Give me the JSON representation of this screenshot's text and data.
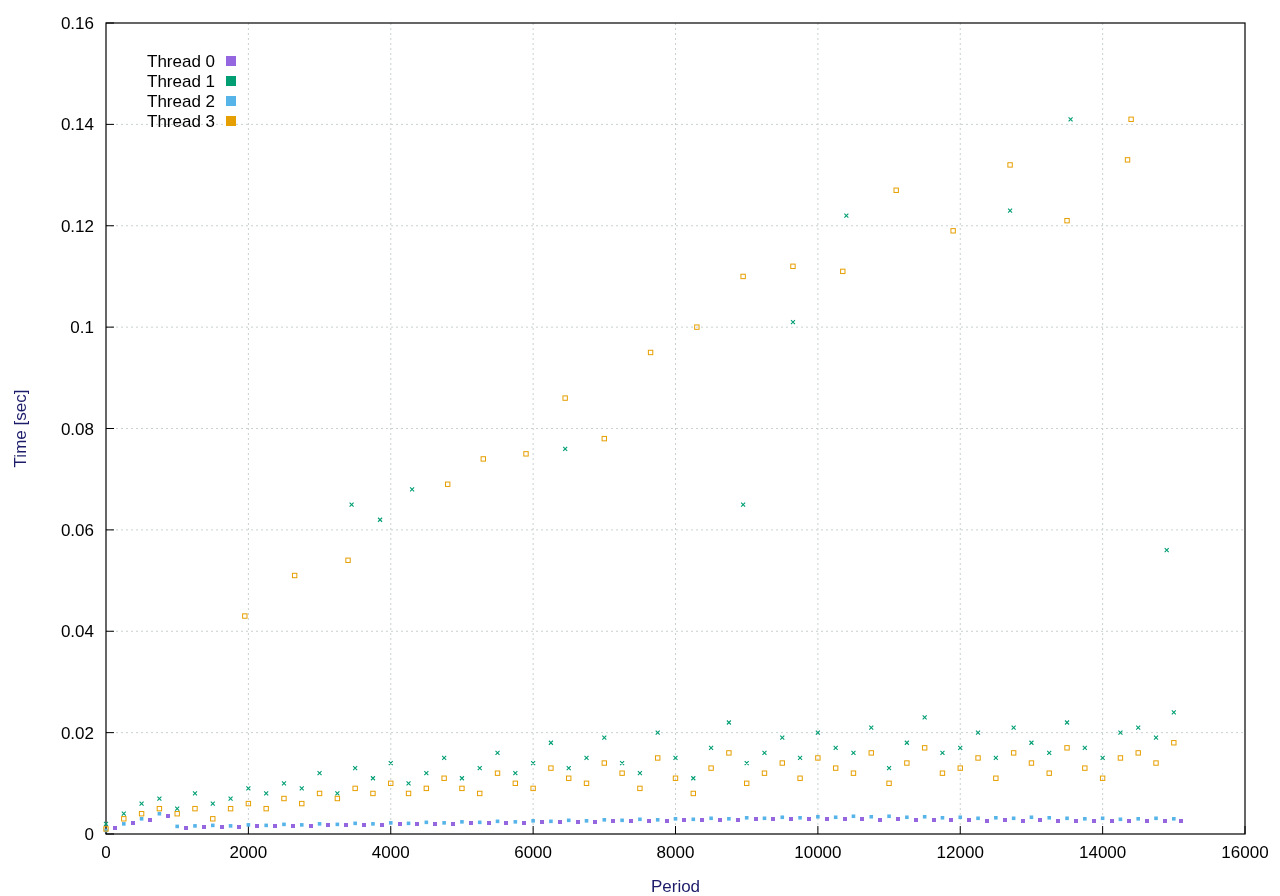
{
  "chart_data": {
    "type": "scatter",
    "grid": true,
    "legend": true,
    "xlabel": "Period",
    "ylabel": "Time [sec]",
    "xlim": [
      0,
      16000
    ],
    "ylim": [
      0,
      0.16
    ],
    "xticks": [
      0,
      2000,
      4000,
      6000,
      8000,
      10000,
      12000,
      14000,
      16000
    ],
    "yticks": [
      0,
      0.02,
      0.04,
      0.06,
      0.08,
      0.1,
      0.12,
      0.14,
      0.16
    ],
    "series": [
      {
        "name": "Thread 0",
        "color": "#9467e0",
        "x": [
          125,
          375,
          625,
          875,
          1125,
          1375,
          1625,
          1875,
          2125,
          2375,
          2625,
          2875,
          3125,
          3375,
          3625,
          3875,
          4125,
          4375,
          4625,
          4875,
          5125,
          5375,
          5625,
          5875,
          6125,
          6375,
          6625,
          6875,
          7125,
          7375,
          7625,
          7875,
          8125,
          8375,
          8625,
          8875,
          9125,
          9375,
          9625,
          9875,
          10125,
          10375,
          10625,
          10875,
          11125,
          11375,
          11625,
          11875,
          12125,
          12375,
          12625,
          12875,
          13125,
          13375,
          13625,
          13875,
          14125,
          14375,
          14625,
          14875,
          15100
        ],
        "values": [
          0.0012,
          0.0022,
          0.0028,
          0.0035,
          0.0012,
          0.0013,
          0.0014,
          0.0014,
          0.0015,
          0.0015,
          0.0016,
          0.0016,
          0.0017,
          0.0017,
          0.0018,
          0.0018,
          0.0019,
          0.0019,
          0.002,
          0.002,
          0.0021,
          0.0021,
          0.0022,
          0.0022,
          0.0023,
          0.0023,
          0.0024,
          0.0024,
          0.0025,
          0.0025,
          0.0026,
          0.0026,
          0.0027,
          0.0027,
          0.0028,
          0.0028,
          0.0029,
          0.0029,
          0.003,
          0.003,
          0.003,
          0.0029,
          0.003,
          0.0028,
          0.0029,
          0.0027,
          0.0028,
          0.0027,
          0.0028,
          0.0026,
          0.0027,
          0.0026,
          0.0027,
          0.0026,
          0.0025,
          0.0026,
          0.0025,
          0.0026,
          0.0025,
          0.0026,
          0.0025
        ]
      },
      {
        "name": "Thread 1",
        "color": "#009e73",
        "x": [
          0,
          250,
          500,
          750,
          1000,
          1250,
          1500,
          1750,
          2000,
          2250,
          2500,
          2750,
          3000,
          3250,
          3500,
          3750,
          4000,
          4250,
          4500,
          4750,
          5000,
          5250,
          5500,
          5750,
          6000,
          6250,
          6500,
          6750,
          7000,
          7250,
          7500,
          7750,
          8000,
          8250,
          8500,
          8750,
          9000,
          9250,
          9500,
          9750,
          10000,
          10250,
          10500,
          10750,
          11000,
          11250,
          11500,
          11750,
          12000,
          12250,
          12500,
          12750,
          13000,
          13250,
          13500,
          13750,
          14000,
          14250,
          14500,
          14750,
          15000,
          3450,
          3850,
          4300,
          6450,
          8950,
          9650,
          10400,
          12700,
          13550,
          14900
        ],
        "values": [
          0.002,
          0.004,
          0.006,
          0.007,
          0.005,
          0.008,
          0.006,
          0.007,
          0.009,
          0.008,
          0.01,
          0.009,
          0.012,
          0.008,
          0.013,
          0.011,
          0.014,
          0.01,
          0.012,
          0.015,
          0.011,
          0.013,
          0.016,
          0.012,
          0.014,
          0.018,
          0.013,
          0.015,
          0.019,
          0.014,
          0.012,
          0.02,
          0.015,
          0.011,
          0.017,
          0.022,
          0.014,
          0.016,
          0.019,
          0.015,
          0.02,
          0.017,
          0.016,
          0.021,
          0.013,
          0.018,
          0.023,
          0.016,
          0.017,
          0.02,
          0.015,
          0.021,
          0.018,
          0.016,
          0.022,
          0.017,
          0.015,
          0.02,
          0.021,
          0.019,
          0.024,
          0.065,
          0.062,
          0.068,
          0.076,
          0.065,
          0.101,
          0.122,
          0.123,
          0.141,
          0.056
        ]
      },
      {
        "name": "Thread 2",
        "color": "#56b4e9",
        "x": [
          0,
          250,
          500,
          750,
          1000,
          1250,
          1500,
          1750,
          2000,
          2250,
          2500,
          2750,
          3000,
          3250,
          3500,
          3750,
          4000,
          4250,
          4500,
          4750,
          5000,
          5250,
          5500,
          5750,
          6000,
          6250,
          6500,
          6750,
          7000,
          7250,
          7500,
          7750,
          8000,
          8250,
          8500,
          8750,
          9000,
          9250,
          9500,
          9750,
          10000,
          10250,
          10500,
          10750,
          11000,
          11250,
          11500,
          11750,
          12000,
          12250,
          12500,
          12750,
          13000,
          13250,
          13500,
          13750,
          14000,
          14250,
          14500,
          14750,
          15000
        ],
        "values": [
          0.0007,
          0.002,
          0.003,
          0.004,
          0.0015,
          0.0016,
          0.0017,
          0.0016,
          0.0018,
          0.0017,
          0.0019,
          0.0018,
          0.002,
          0.0019,
          0.0021,
          0.002,
          0.0022,
          0.0021,
          0.0023,
          0.0022,
          0.0024,
          0.0023,
          0.0025,
          0.0024,
          0.0026,
          0.0025,
          0.0027,
          0.0026,
          0.0028,
          0.0027,
          0.0029,
          0.0028,
          0.003,
          0.0029,
          0.0031,
          0.003,
          0.0032,
          0.0031,
          0.0033,
          0.0032,
          0.0034,
          0.0033,
          0.0035,
          0.0034,
          0.0035,
          0.0033,
          0.0034,
          0.0032,
          0.0033,
          0.0031,
          0.0032,
          0.0031,
          0.0033,
          0.0032,
          0.0031,
          0.003,
          0.0031,
          0.0029,
          0.003,
          0.0031,
          0.003
        ]
      },
      {
        "name": "Thread 3",
        "color": "#e69f00",
        "x": [
          0,
          250,
          500,
          750,
          1000,
          1250,
          1500,
          1750,
          2000,
          2250,
          2500,
          2750,
          3000,
          3250,
          3500,
          3750,
          4000,
          4250,
          4500,
          4750,
          5000,
          5250,
          5500,
          5750,
          6000,
          6250,
          6500,
          6750,
          7000,
          7250,
          7500,
          7750,
          8000,
          8250,
          8500,
          8750,
          9000,
          9250,
          9500,
          9750,
          10000,
          10250,
          10500,
          10750,
          11000,
          11250,
          11500,
          11750,
          12000,
          12250,
          12500,
          12750,
          13000,
          13250,
          13500,
          13750,
          14000,
          14250,
          14500,
          14750,
          15000,
          1950,
          2650,
          3400,
          4800,
          5300,
          5900,
          6450,
          7000,
          7650,
          8300,
          8950,
          9650,
          10350,
          11100,
          11900,
          12700,
          13500,
          14350,
          14400
        ],
        "values": [
          0.001,
          0.003,
          0.004,
          0.005,
          0.004,
          0.005,
          0.003,
          0.005,
          0.006,
          0.005,
          0.007,
          0.006,
          0.008,
          0.007,
          0.009,
          0.008,
          0.01,
          0.008,
          0.009,
          0.011,
          0.009,
          0.008,
          0.012,
          0.01,
          0.009,
          0.013,
          0.011,
          0.01,
          0.014,
          0.012,
          0.009,
          0.015,
          0.011,
          0.008,
          0.013,
          0.016,
          0.01,
          0.012,
          0.014,
          0.011,
          0.015,
          0.013,
          0.012,
          0.016,
          0.01,
          0.014,
          0.017,
          0.012,
          0.013,
          0.015,
          0.011,
          0.016,
          0.014,
          0.012,
          0.017,
          0.013,
          0.011,
          0.015,
          0.016,
          0.014,
          0.018,
          0.043,
          0.051,
          0.054,
          0.069,
          0.074,
          0.075,
          0.086,
          0.078,
          0.095,
          0.1,
          0.11,
          0.112,
          0.111,
          0.127,
          0.119,
          0.132,
          0.121,
          0.133,
          0.141
        ]
      }
    ]
  }
}
